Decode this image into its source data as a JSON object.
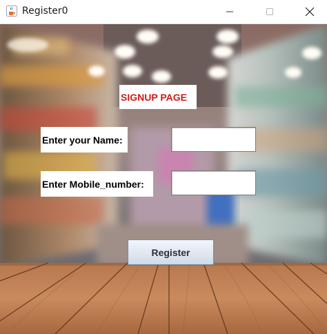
{
  "window": {
    "title": "Register0",
    "app_icon": "java-cup-icon",
    "controls": [
      "minimize-icon",
      "maximize-icon",
      "close-icon"
    ]
  },
  "form": {
    "heading": "SIGNUP PAGE",
    "heading_color": "#d11a1a",
    "name_label": "Enter your Name:",
    "name_value": "",
    "mobile_label": "Enter Mobile_number:",
    "mobile_value": "",
    "register_label": "Register"
  },
  "background": {
    "description_icon": "supermarket-aisle-with-wooden-floor"
  }
}
